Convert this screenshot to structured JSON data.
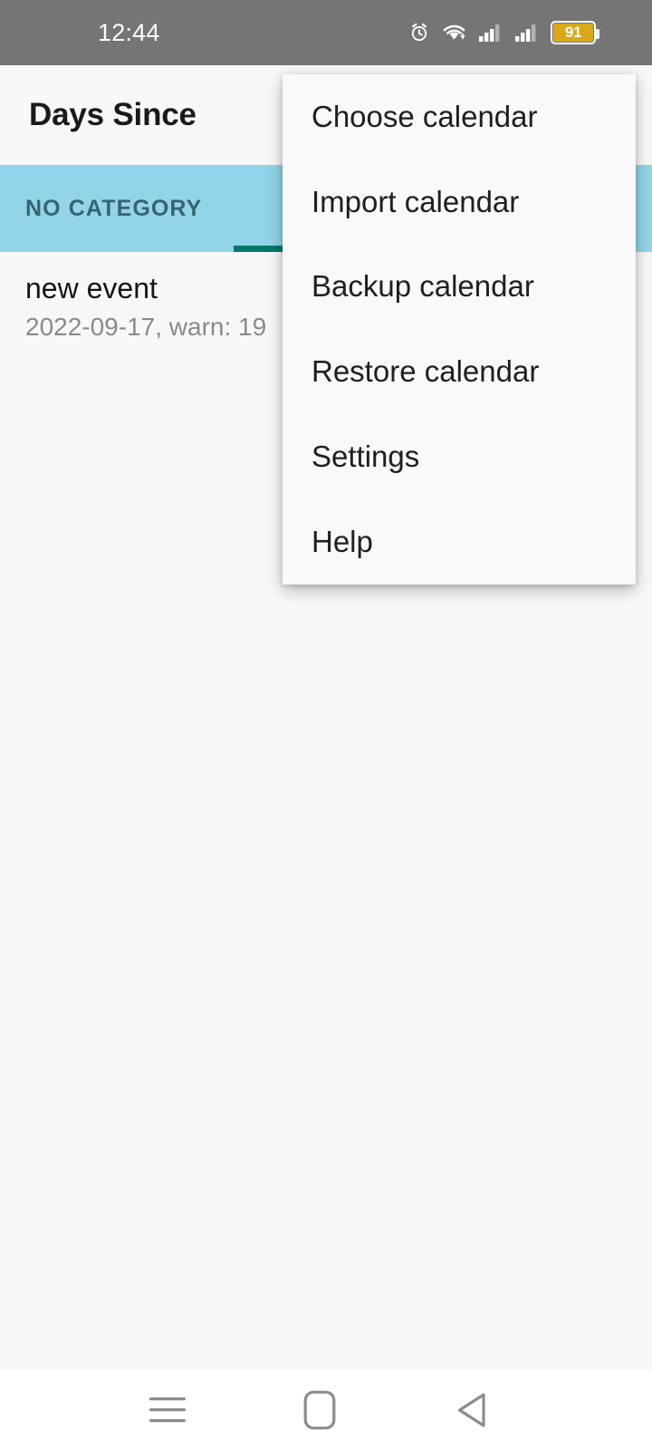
{
  "status_bar": {
    "time": "12:44",
    "battery_percent": "91",
    "icons": [
      "alarm-icon",
      "wifi-icon",
      "signal-icon",
      "signal-icon",
      "battery-icon"
    ],
    "background_color": "#757575",
    "text_color": "#FFFFFF",
    "battery_fill_color": "#D9A919"
  },
  "app_bar": {
    "title": "Days Since",
    "background_color": "#F8F8F8"
  },
  "tabs": {
    "background_color": "#92D5E8",
    "label_color": "#37636F",
    "indicator_color": "#00796B",
    "selected_index": 1,
    "items": [
      {
        "label": "NO CATEGORY"
      },
      {
        "label": ""
      }
    ]
  },
  "event_list": {
    "items": [
      {
        "title": "new event",
        "subtitle": "2022-09-17, warn: 19"
      }
    ]
  },
  "overflow_menu": {
    "visible": true,
    "background_color": "#F9F9F9",
    "items": [
      {
        "label": "Choose calendar"
      },
      {
        "label": "Import calendar"
      },
      {
        "label": "Backup calendar"
      },
      {
        "label": "Restore calendar"
      },
      {
        "label": "Settings"
      },
      {
        "label": "Help"
      }
    ]
  },
  "nav_bar": {
    "background_color": "#FFFFFF",
    "buttons": [
      {
        "name": "recents",
        "icon": "hamburger-icon"
      },
      {
        "name": "home",
        "icon": "square-icon"
      },
      {
        "name": "back",
        "icon": "triangle-left-icon"
      }
    ]
  }
}
